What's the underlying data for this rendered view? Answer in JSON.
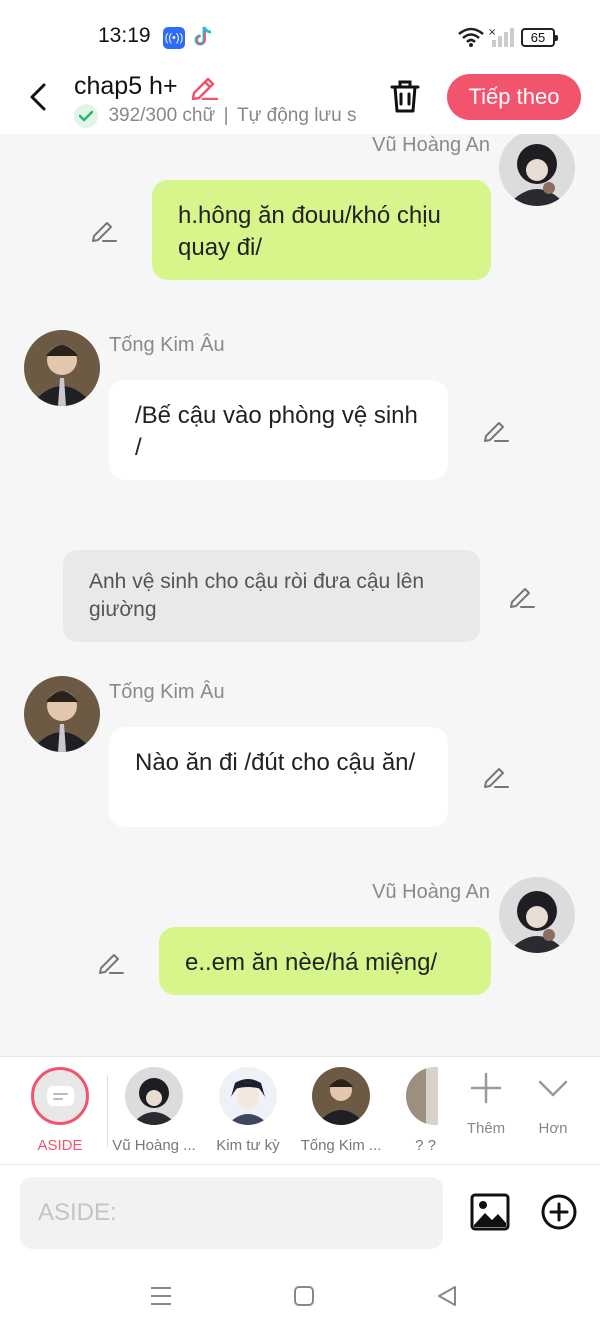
{
  "status_bar": {
    "time": "13:19",
    "battery": "65",
    "icons": [
      "radio-app-icon",
      "tiktok-icon",
      "wifi-icon",
      "signal-icon",
      "battery-icon"
    ]
  },
  "header": {
    "title": "chap5 h+",
    "word_count": "392/300 chữ",
    "autosave": "Tự động lưu s",
    "next_label": "Tiếp theo",
    "accent_color": "#f3546d"
  },
  "messages": [
    {
      "type": "right",
      "speaker": "Vũ Hoàng An",
      "text": "h.hông ăn đouu/khó chịu quay đi/"
    },
    {
      "type": "left",
      "speaker": "Tống Kim Âu",
      "text": "/Bế cậu vào phòng vệ sinh /"
    },
    {
      "type": "aside",
      "text": "Anh vệ sinh cho cậu ròi đưa cậu lên giường"
    },
    {
      "type": "left",
      "speaker": "Tống Kim Âu",
      "text": "Nào ăn đi /đút cho cậu ăn/"
    },
    {
      "type": "right",
      "speaker": "Vũ Hoàng An",
      "text": "e..em ăn nèe/há miệng/"
    }
  ],
  "roles": [
    {
      "label": "ASIDE",
      "active": true
    },
    {
      "label": "Vũ Hoàng ..."
    },
    {
      "label": "Kim tư kỳ"
    },
    {
      "label": "Tống Kim ..."
    },
    {
      "label": "? ?"
    }
  ],
  "tools": {
    "add_label": "Thêm",
    "more_label": "Hơn"
  },
  "input": {
    "placeholder": "ASIDE:"
  }
}
